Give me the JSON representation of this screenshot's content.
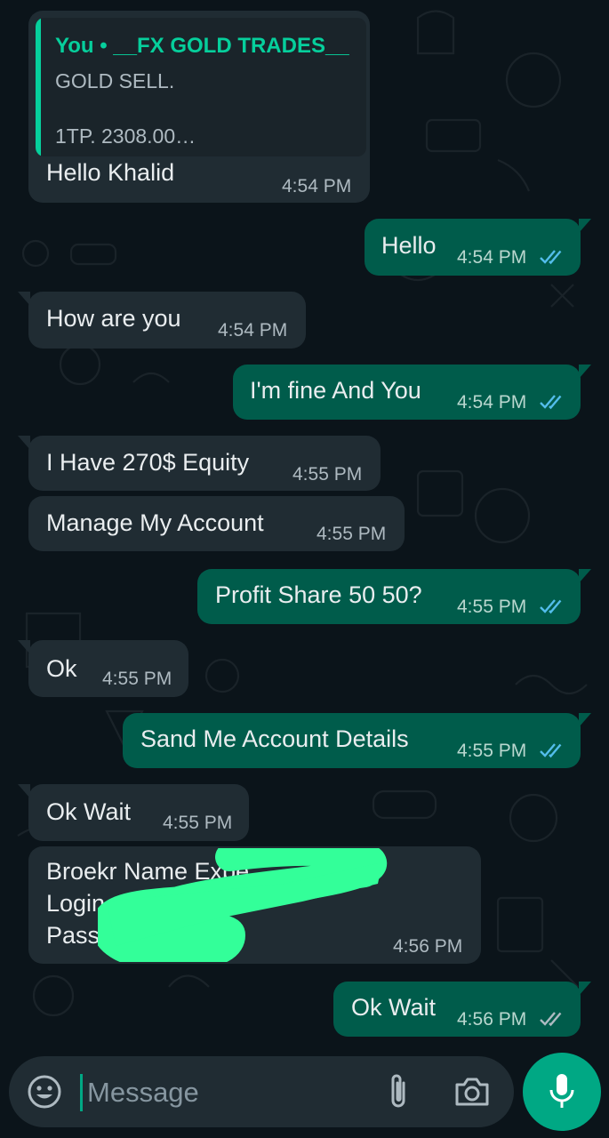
{
  "quoted": {
    "sender": "You • __FX GOLD TRADES__",
    "line1": "GOLD SELL.",
    "line2": "1TP.  2308.00…"
  },
  "messages": [
    {
      "direction": "in",
      "text": "Hello Khalid",
      "time": "4:54 PM"
    },
    {
      "direction": "out",
      "text": "Hello",
      "time": "4:54 PM",
      "status": "read"
    },
    {
      "direction": "in",
      "text": "How are you",
      "time": "4:54 PM"
    },
    {
      "direction": "out",
      "text": "I'm fine And You",
      "time": "4:54 PM",
      "status": "read"
    },
    {
      "direction": "in",
      "text": "I Have 270$ Equity",
      "time": "4:55 PM"
    },
    {
      "direction": "in",
      "text": "Manage My Account",
      "time": "4:55 PM"
    },
    {
      "direction": "out",
      "text": "Profit Share 50 50?",
      "time": "4:55 PM",
      "status": "read"
    },
    {
      "direction": "in",
      "text": "Ok",
      "time": "4:55 PM"
    },
    {
      "direction": "out",
      "text": "Sand Me Account Details",
      "time": "4:55 PM",
      "status": "read"
    },
    {
      "direction": "in",
      "text": "Ok Wait",
      "time": "4:55 PM"
    },
    {
      "direction": "in",
      "lines": [
        "Broekr Name Expe",
        "Login",
        "Pass"
      ],
      "time": "4:56 PM",
      "redacted": true
    },
    {
      "direction": "out",
      "text": "Ok Wait",
      "time": "4:56 PM",
      "status": "delivered"
    }
  ],
  "composer": {
    "placeholder": "Message"
  },
  "icons": {
    "emoji": "emoji-icon",
    "attach": "paperclip-icon",
    "camera": "camera-icon",
    "mic": "microphone-icon",
    "read_ticks": "double-check-icon"
  },
  "colors": {
    "background": "#0b141a",
    "incoming": "#202c33",
    "outgoing": "#005c4b",
    "accent": "#00a884",
    "read_ticks": "#53bdeb",
    "delivered_ticks": "#aebac1",
    "redaction": "#33ff99"
  }
}
